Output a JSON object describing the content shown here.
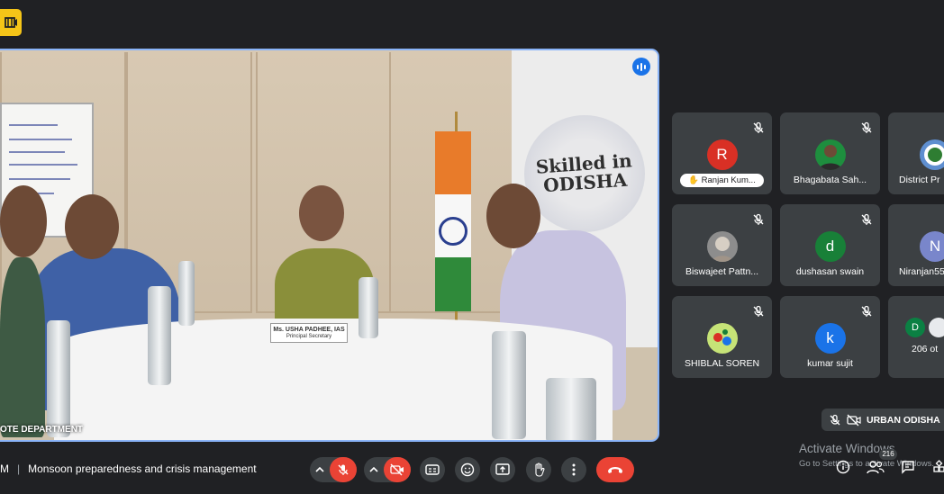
{
  "window": {
    "title": "Google Meet"
  },
  "main_video": {
    "label": "OTE DEPARTMENT",
    "poster_text": "Skilled in ODISHA",
    "nameplate_name": "Ms. USHA PADHEE, IAS",
    "nameplate_title": "Principal Secretary"
  },
  "participants": [
    {
      "name": "Ranjan Kum...",
      "initial": "R",
      "color": "#d93025",
      "raised_hand": true
    },
    {
      "name": "Bhagabata Sah...",
      "initial": "",
      "color": "#1e8e3e"
    },
    {
      "name": "District Pr",
      "initial": "",
      "color": "#5f8fd0"
    },
    {
      "name": "Biswajeet Pattn...",
      "initial": "",
      "color": "#8d8d8d"
    },
    {
      "name": "dushasan swain",
      "initial": "d",
      "color": "#188038"
    },
    {
      "name": "Niranjan55",
      "initial": "N",
      "color": "#7986cb"
    },
    {
      "name": "SHIBLAL SOREN",
      "initial": "",
      "color": "#c6e377"
    },
    {
      "name": "kumar sujit",
      "initial": "k",
      "color": "#1a73e8"
    },
    {
      "name": "206 ot",
      "initial": "D",
      "color": "#0b8043"
    }
  ],
  "presenter_bar": {
    "label": "URBAN ODISHA"
  },
  "overlay": {
    "activate_title": "Activate Windows",
    "activate_sub": "Go to Settings to activate Windows."
  },
  "meeting": {
    "time_fragment": "M",
    "title": "Monsoon preparedness and crisis management"
  },
  "controls": {
    "participant_count": "216"
  },
  "colors": {
    "accent": "#8ab4f8",
    "end_call": "#ea4335",
    "tile_bg": "#3c4043",
    "page_bg": "#202124"
  }
}
